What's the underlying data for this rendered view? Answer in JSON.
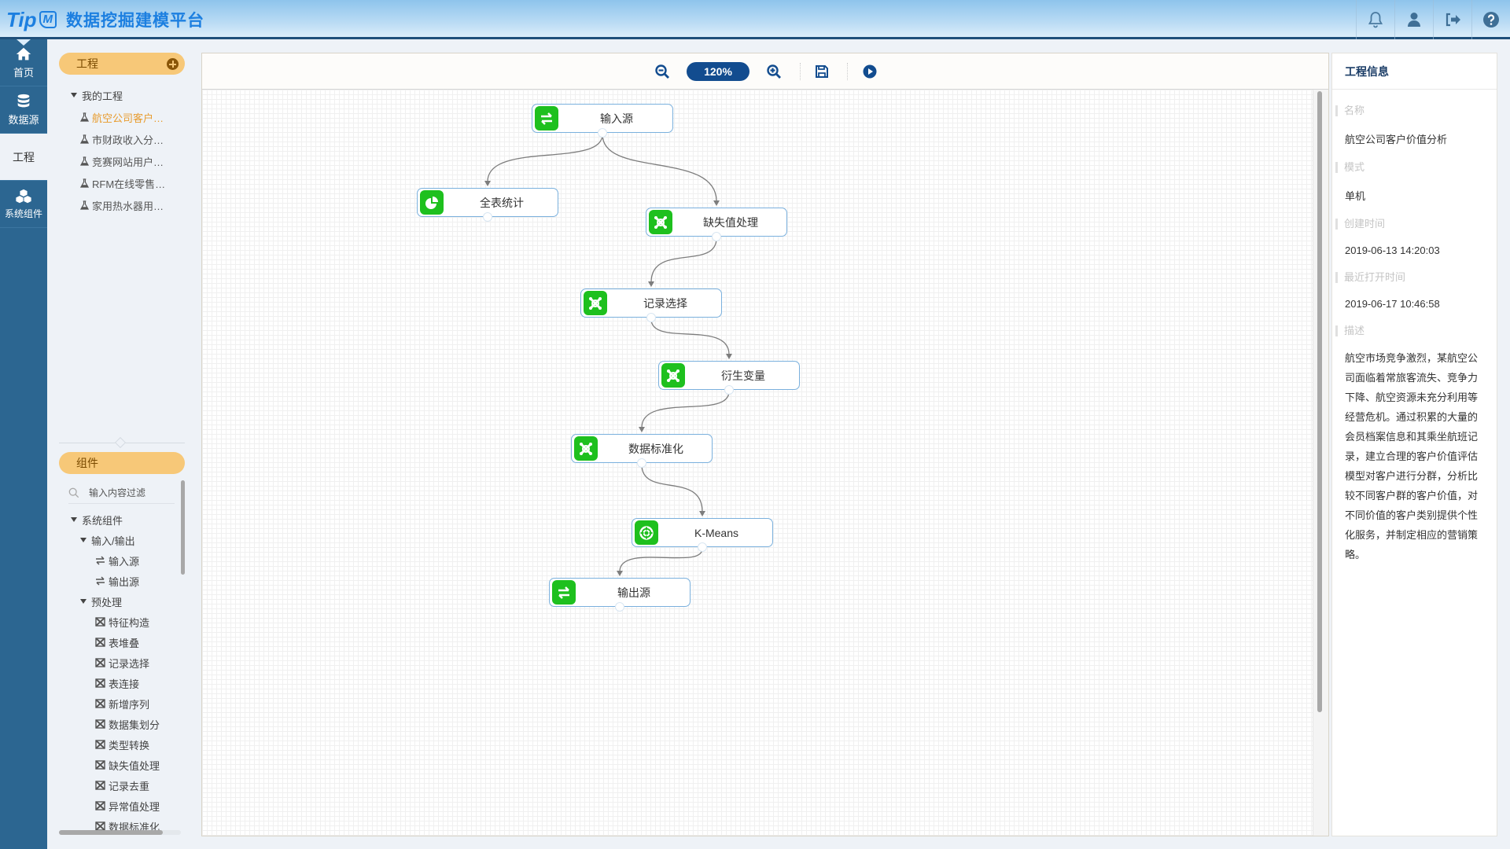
{
  "header": {
    "logo_text": "Tip",
    "logo_badge": "M",
    "app_title": "数据挖掘建模平台",
    "icons": [
      "bell-icon",
      "user-icon",
      "logout-icon",
      "help-icon"
    ]
  },
  "leftnav": {
    "items": [
      {
        "label": "首页",
        "icon": "home-icon"
      },
      {
        "label": "数据源",
        "icon": "database-icon"
      },
      {
        "label": "工程",
        "icon": "",
        "active": true
      },
      {
        "label": "系统组件",
        "icon": "cubes-icon"
      }
    ]
  },
  "sidebar": {
    "projects_header": "工程",
    "projects_root": "我的工程",
    "projects": [
      {
        "label": "航空公司客户…",
        "active": true
      },
      {
        "label": "市财政收入分…"
      },
      {
        "label": "竞赛网站用户…"
      },
      {
        "label": "RFM在线零售…"
      },
      {
        "label": "家用热水器用…"
      }
    ],
    "components_header": "组件",
    "filter_placeholder": "输入内容过滤",
    "comp_root": "系统组件",
    "groups": [
      {
        "label": "输入/输出",
        "items": [
          "输入源",
          "输出源"
        ]
      },
      {
        "label": "预处理",
        "items": [
          "特征构造",
          "表堆叠",
          "记录选择",
          "表连接",
          "新增序列",
          "数据集划分",
          "类型转换",
          "缺失值处理",
          "记录去重",
          "异常值处理",
          "数据标准化"
        ]
      }
    ]
  },
  "toolbar": {
    "zoom_level": "120%",
    "buttons": [
      "zoom-out-icon",
      "zoom-in-icon",
      "save-icon",
      "run-icon"
    ]
  },
  "flow": {
    "nodes": [
      {
        "id": "n1",
        "label": "输入源",
        "icon": "swap"
      },
      {
        "id": "n2",
        "label": "全表统计",
        "icon": "pie"
      },
      {
        "id": "n3",
        "label": "缺失值处理",
        "icon": "process"
      },
      {
        "id": "n4",
        "label": "记录选择",
        "icon": "process"
      },
      {
        "id": "n5",
        "label": "衍生变量",
        "icon": "process"
      },
      {
        "id": "n6",
        "label": "数据标准化",
        "icon": "process"
      },
      {
        "id": "n7",
        "label": "K-Means",
        "icon": "cluster"
      },
      {
        "id": "n8",
        "label": "输出源",
        "icon": "swap"
      }
    ],
    "edges": [
      [
        "n1",
        "n2"
      ],
      [
        "n1",
        "n3"
      ],
      [
        "n3",
        "n4"
      ],
      [
        "n4",
        "n5"
      ],
      [
        "n5",
        "n6"
      ],
      [
        "n6",
        "n7"
      ],
      [
        "n7",
        "n8"
      ]
    ]
  },
  "info": {
    "title": "工程信息",
    "name_label": "名称",
    "name_value": "航空公司客户价值分析",
    "mode_label": "模式",
    "mode_value": "单机",
    "created_label": "创建时间",
    "created_value": "2019-06-13 14:20:03",
    "opened_label": "最近打开时间",
    "opened_value": "2019-06-17 10:46:58",
    "desc_label": "描述",
    "desc_value": "航空市场竞争激烈，某航空公司面临着常旅客流失、竞争力下降、航空资源未充分利用等经营危机。通过积累的大量的会员档案信息和其乘坐航班记录，建立合理的客户价值评估模型对客户进行分群，分析比较不同客户群的客户价值，对不同价值的客户类别提供个性化服务，并制定相应的营销策略。"
  }
}
